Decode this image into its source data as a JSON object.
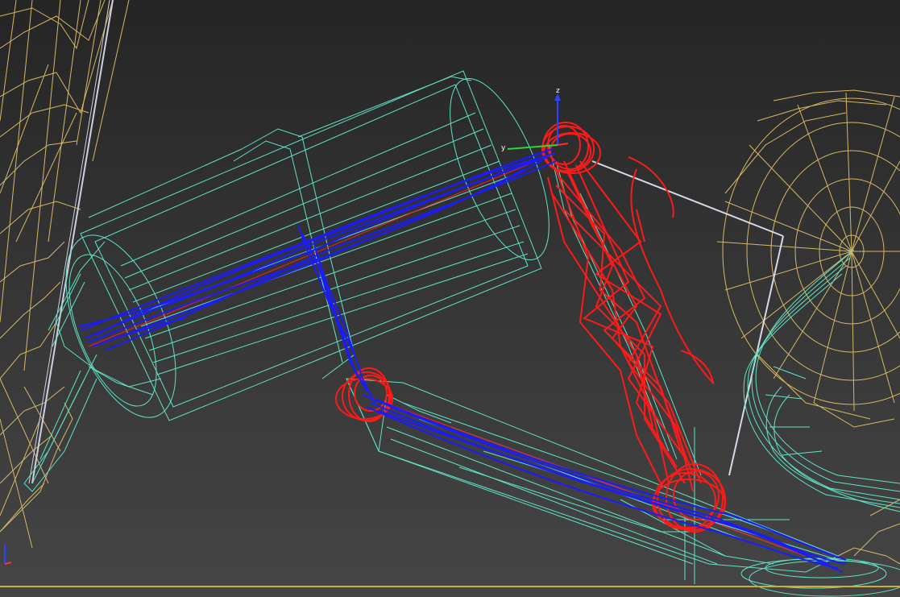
{
  "viewport": {
    "gizmo": {
      "z_label": "z",
      "y_label": "y"
    },
    "colors": {
      "mesh_cyan": "#5fe3c6",
      "mesh_yellow": "#e8c66a",
      "stroke_red": "#ff1a1a",
      "stroke_blue": "#1b1bff",
      "link_white": "#d8d8e8",
      "axis_z": "#2a44ff",
      "axis_y": "#2bd83b",
      "axis_x": "#ff3030",
      "grid_line": "#c8b037"
    }
  }
}
